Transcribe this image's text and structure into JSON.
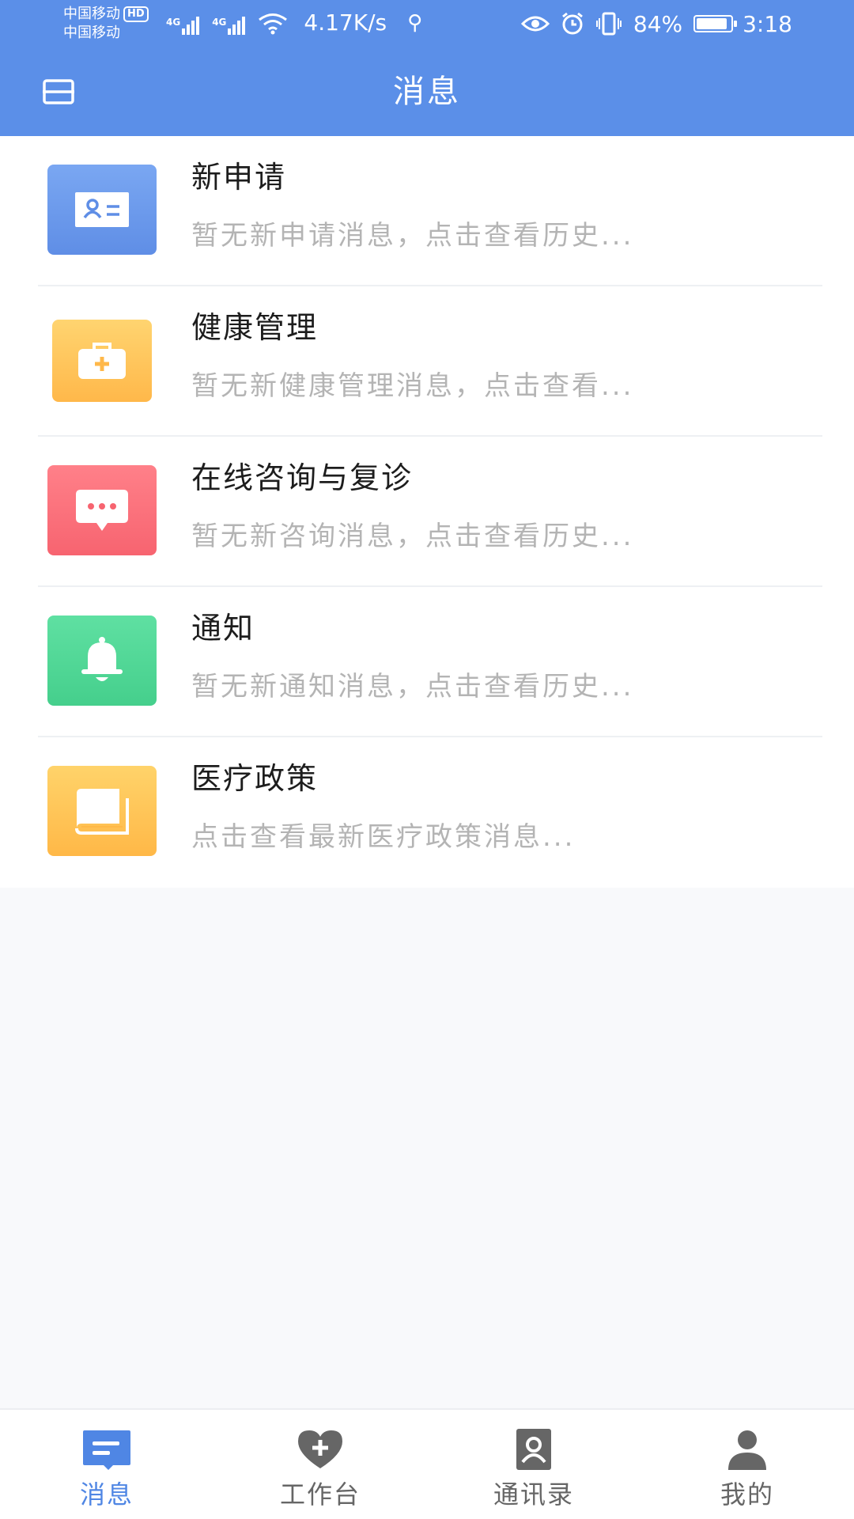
{
  "status_bar": {
    "carrier_1": "中国移动",
    "carrier_hd": "HD",
    "carrier_2": "中国移动",
    "sim1_tag": "4G",
    "sim2_tag": "4G",
    "net_speed": "4.17K/s",
    "battery": "84%",
    "time": "3:18"
  },
  "header": {
    "title": "消息"
  },
  "messages": [
    {
      "title": "新申请",
      "subtitle": "暂无新申请消息，点击查看历史...",
      "icon": "id-card-icon",
      "color": "#6f9cee"
    },
    {
      "title": "健康管理",
      "subtitle": "暂无新健康管理消息，点击查看...",
      "icon": "medical-kit-icon",
      "color": "#ffc45c"
    },
    {
      "title": "在线咨询与复诊",
      "subtitle": "暂无新咨询消息，点击查看历史...",
      "icon": "chat-bubble-icon",
      "color": "#f9707b"
    },
    {
      "title": "通知",
      "subtitle": "暂无新通知消息，点击查看历史...",
      "icon": "bell-icon",
      "color": "#4fd796"
    },
    {
      "title": "医疗政策",
      "subtitle": "点击查看最新医疗政策消息...",
      "icon": "book-icon",
      "color": "#ffc259"
    }
  ],
  "bottom_nav": [
    {
      "label": "消息",
      "icon": "message-icon",
      "active": true
    },
    {
      "label": "工作台",
      "icon": "heart-plus-icon",
      "active": false
    },
    {
      "label": "通讯录",
      "icon": "contacts-icon",
      "active": false
    },
    {
      "label": "我的",
      "icon": "profile-icon",
      "active": false
    }
  ],
  "colors": {
    "header_bg": "#5b8fe8",
    "nav_active": "#4f86e4",
    "nav_inactive": "#666666",
    "subtitle": "#b4b4b4"
  }
}
